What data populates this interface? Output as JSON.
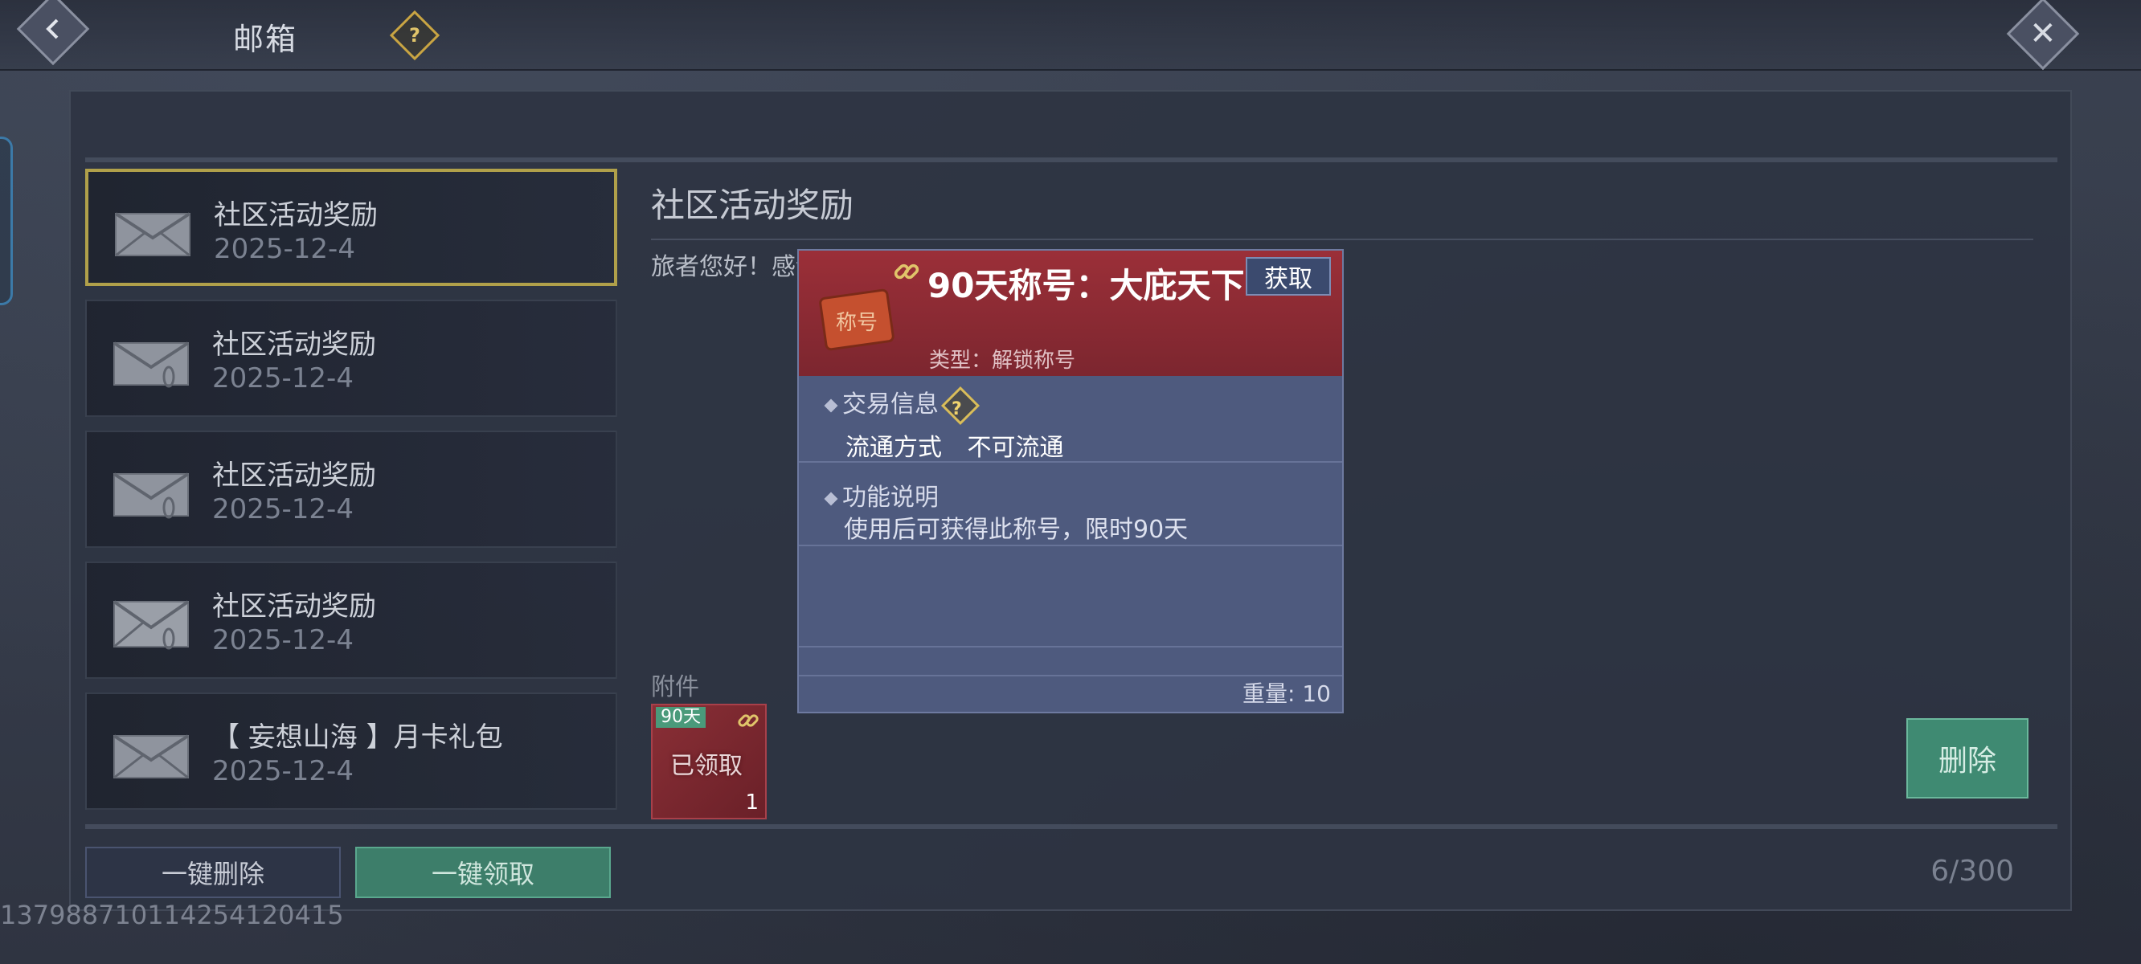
{
  "header": {
    "title": "邮箱",
    "back_icon": "chevron-left-icon",
    "help_icon": "question-icon",
    "close_icon": "close-icon"
  },
  "mail_list": [
    {
      "title": "社区活动奖励",
      "date": "2025-12-4",
      "selected": true
    },
    {
      "title": "社区活动奖励",
      "date": "2025-12-4",
      "selected": false
    },
    {
      "title": "社区活动奖励",
      "date": "2025-12-4",
      "selected": false
    },
    {
      "title": "社区活动奖励",
      "date": "2025-12-4",
      "selected": false
    },
    {
      "title": "【 妄想山海 】月卡礼包",
      "date": "2025-12-4",
      "selected": false
    }
  ],
  "content": {
    "title": "社区活动奖励",
    "body": "旅者您好！感谢您参与"
  },
  "attachment": {
    "label": "附件",
    "badge": "90天",
    "status": "已领取",
    "count": "1"
  },
  "tooltip": {
    "title": "90天称号：大庇天下",
    "obtain_label": "获取",
    "type": "类型：解锁称号",
    "trade_section": "交易信息",
    "circulation_label": "流通方式",
    "circulation_value": "不可流通",
    "function_section": "功能说明",
    "function_desc": "使用后可获得此称号，限时90天",
    "weight": "重量: 10"
  },
  "actions": {
    "delete": "删除",
    "delete_all": "一键删除",
    "claim_all": "一键领取"
  },
  "mail_count": "6/300",
  "uid": "1379887101142541204​15",
  "colors": {
    "selected_border": "#b0a04a",
    "claim_green": "#3d7e6a",
    "tooltip_red": "#9b2f38",
    "tooltip_body": "#4e5a7e"
  }
}
